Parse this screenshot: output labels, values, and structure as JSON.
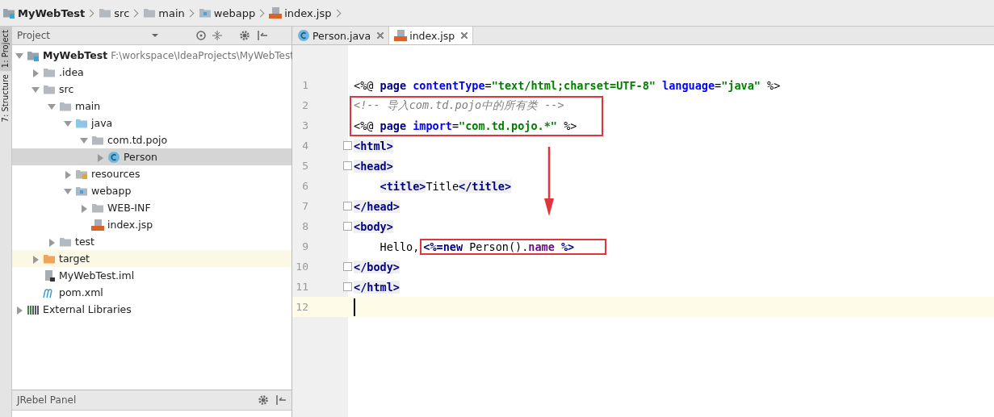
{
  "breadcrumbs": [
    {
      "label": "MyWebTest",
      "kind": "module"
    },
    {
      "label": "src",
      "kind": "folder"
    },
    {
      "label": "main",
      "kind": "folder"
    },
    {
      "label": "webapp",
      "kind": "web"
    },
    {
      "label": "index.jsp",
      "kind": "jsp"
    }
  ],
  "tool_strip": [
    "1: Project",
    "7: Structure"
  ],
  "project_panel": {
    "title": "Project",
    "tree": [
      {
        "label": "MyWebTest",
        "path": "F:\\workspace\\IdeaProjects\\MyWebTest",
        "kind": "module",
        "expanded": true,
        "selected": false,
        "highlighted": false,
        "children": [
          {
            "label": ".idea",
            "kind": "folder",
            "expanded": false,
            "selected": false,
            "highlighted": false
          },
          {
            "label": "src",
            "kind": "folder",
            "expanded": true,
            "selected": false,
            "highlighted": false,
            "children": [
              {
                "label": "main",
                "kind": "folder",
                "expanded": true,
                "selected": false,
                "highlighted": false,
                "children": [
                  {
                    "label": "java",
                    "kind": "source",
                    "expanded": true,
                    "selected": false,
                    "highlighted": false,
                    "children": [
                      {
                        "label": "com.td.pojo",
                        "kind": "package",
                        "expanded": true,
                        "selected": false,
                        "highlighted": false,
                        "children": [
                          {
                            "label": "Person",
                            "kind": "class",
                            "expanded": false,
                            "selected": true,
                            "highlighted": false
                          }
                        ]
                      }
                    ]
                  },
                  {
                    "label": "resources",
                    "kind": "resources",
                    "expanded": false,
                    "selected": false,
                    "highlighted": false
                  },
                  {
                    "label": "webapp",
                    "kind": "web",
                    "expanded": true,
                    "selected": false,
                    "highlighted": false,
                    "children": [
                      {
                        "label": "WEB-INF",
                        "kind": "folder",
                        "expanded": false,
                        "selected": false,
                        "highlighted": false
                      },
                      {
                        "label": "index.jsp",
                        "kind": "jsp",
                        "selected": false,
                        "highlighted": false
                      }
                    ]
                  }
                ]
              },
              {
                "label": "test",
                "kind": "folder",
                "expanded": false,
                "selected": false,
                "highlighted": false
              }
            ]
          },
          {
            "label": "target",
            "kind": "excluded",
            "expanded": false,
            "selected": false,
            "highlighted": true
          },
          {
            "label": "MyWebTest.iml",
            "kind": "iml",
            "selected": false,
            "highlighted": false
          },
          {
            "label": "pom.xml",
            "kind": "maven",
            "selected": false,
            "highlighted": false
          }
        ]
      },
      {
        "label": "External Libraries",
        "kind": "libraries",
        "expanded": false,
        "selected": false,
        "highlighted": false
      }
    ]
  },
  "jrebel_panel": {
    "title": "JRebel Panel"
  },
  "tabs": [
    {
      "label": "Person.java",
      "kind": "class",
      "selected": false
    },
    {
      "label": "index.jsp",
      "kind": "jsp",
      "selected": true
    }
  ],
  "editor": {
    "lines": [
      {
        "number": "1",
        "fold": false,
        "current": false,
        "indented": false,
        "tokens": [
          {
            "t": "<%@ ",
            "kind": "plain"
          },
          {
            "t": "page ",
            "kind": "kw"
          },
          {
            "t": "contentType",
            "kind": "attr"
          },
          {
            "t": "=",
            "kind": "plain"
          },
          {
            "t": "\"text/html;charset=UTF-8\"",
            "kind": "str"
          },
          {
            "t": " language",
            "kind": "attr"
          },
          {
            "t": "=",
            "kind": "plain"
          },
          {
            "t": "\"java\"",
            "kind": "str"
          },
          {
            "t": " %>",
            "kind": "plain"
          }
        ]
      },
      {
        "number": "2",
        "fold": false,
        "current": false,
        "indented": false,
        "tokens": [
          {
            "t": "<!-- 导入com.td.pojo中的所有类 -->",
            "kind": "comment"
          }
        ]
      },
      {
        "number": "3",
        "fold": false,
        "current": false,
        "indented": false,
        "tokens": [
          {
            "t": "<%@ ",
            "kind": "plain"
          },
          {
            "t": "page ",
            "kind": "kw"
          },
          {
            "t": "import",
            "kind": "attr"
          },
          {
            "t": "=",
            "kind": "plain"
          },
          {
            "t": "\"com.td.pojo.*\"",
            "kind": "str"
          },
          {
            "t": " %>",
            "kind": "plain"
          }
        ]
      },
      {
        "number": "4",
        "fold": true,
        "current": false,
        "indented": false,
        "tokens": [
          {
            "t": "<html>",
            "kind": "tag"
          }
        ]
      },
      {
        "number": "5",
        "fold": true,
        "current": false,
        "indented": false,
        "tokens": [
          {
            "t": "<head>",
            "kind": "tag"
          }
        ]
      },
      {
        "number": "6",
        "fold": false,
        "current": false,
        "indented": true,
        "tokens": [
          {
            "t": "<title>",
            "kind": "tag"
          },
          {
            "t": "Title",
            "kind": "plain"
          },
          {
            "t": "</title>",
            "kind": "tag"
          }
        ]
      },
      {
        "number": "7",
        "fold": true,
        "current": false,
        "indented": false,
        "tokens": [
          {
            "t": "</head>",
            "kind": "tag"
          }
        ]
      },
      {
        "number": "8",
        "fold": true,
        "current": false,
        "indented": false,
        "tokens": [
          {
            "t": "<body>",
            "kind": "tag"
          }
        ]
      },
      {
        "number": "9",
        "fold": false,
        "current": false,
        "indented": true,
        "tokens": [
          {
            "t": "Hello,",
            "kind": "plain"
          }
        ],
        "framed_tokens": [
          {
            "t": "<%=",
            "kind": "kw"
          },
          {
            "t": "new ",
            "kind": "kw"
          },
          {
            "t": "Person().",
            "kind": "plain"
          },
          {
            "t": "name",
            "kind": "field"
          },
          {
            "t": " %>",
            "kind": "kw"
          }
        ]
      },
      {
        "number": "10",
        "fold": true,
        "current": false,
        "indented": false,
        "tokens": [
          {
            "t": "</body>",
            "kind": "tag"
          }
        ]
      },
      {
        "number": "11",
        "fold": true,
        "current": false,
        "indented": false,
        "tokens": [
          {
            "t": "</html>",
            "kind": "tag"
          }
        ]
      },
      {
        "number": "12",
        "fold": false,
        "current": true,
        "indented": false
      }
    ]
  }
}
